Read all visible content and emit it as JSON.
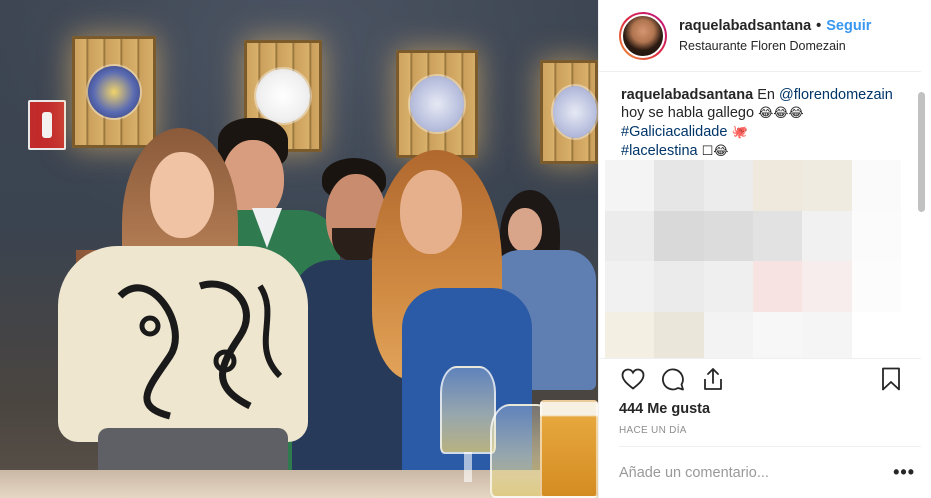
{
  "post": {
    "username": "raquelabadsantana",
    "separator": "•",
    "follow_label": "Seguir",
    "location": "Restaurante Floren Domezain",
    "caption": {
      "user": "raquelabadsantana",
      "text_prefix": "En",
      "mention": "@florendomezain",
      "line2": "hoy se habla gallego",
      "line2_emoji": "😂😂😂",
      "hashtag1": "#Galiciacalidade",
      "hashtag1_emoji": "🐙",
      "hashtag2": "#lacelestina",
      "hashtag2_emoji": "☐😂"
    },
    "likes": "444 Me gusta",
    "time": "HACE UN DÍA",
    "comment_placeholder": "Añade un comentario...",
    "more_label": "•••"
  },
  "icons": {
    "like": "heart-icon",
    "comment": "comment-icon",
    "share": "share-icon",
    "save": "bookmark-icon",
    "more": "more-options-icon"
  },
  "colors": {
    "link": "#3897f0",
    "hashtag": "#003569",
    "muted": "#8e8e8e"
  }
}
